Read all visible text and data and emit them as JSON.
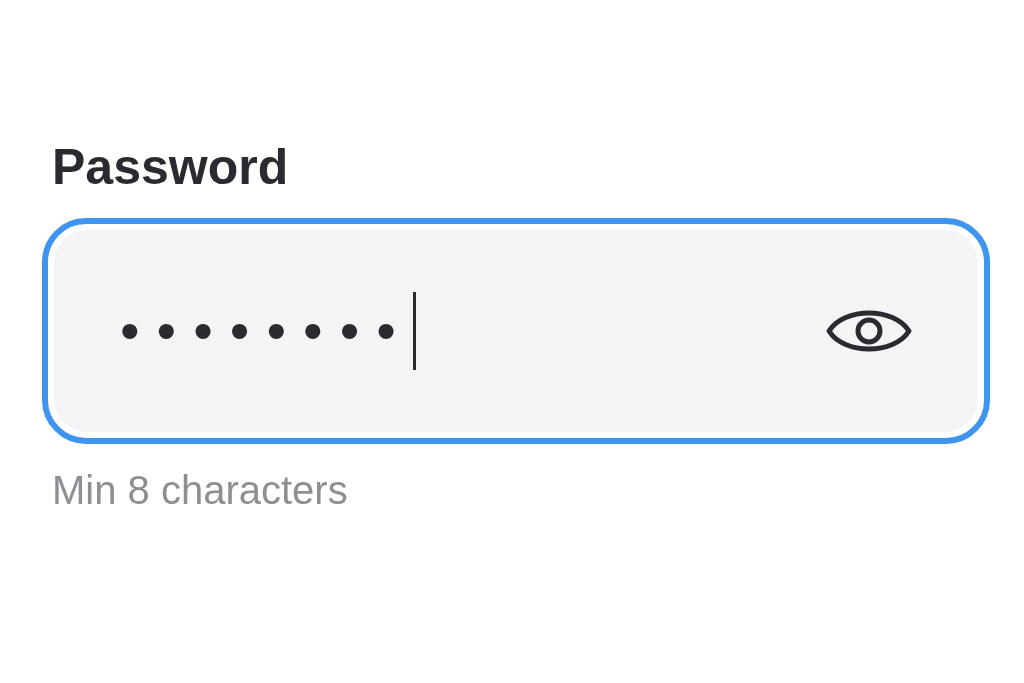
{
  "label": "Password",
  "field": {
    "value": "••••••••",
    "focused": true
  },
  "hint": "Min 8 characters"
}
